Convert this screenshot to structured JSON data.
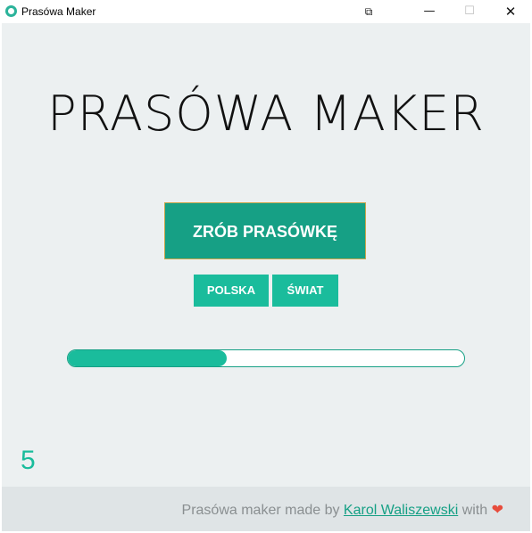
{
  "window": {
    "title": "Prasówa Maker",
    "controls": {
      "extra": "⧉",
      "minimize": "—",
      "maximize": "☐",
      "close": "✕"
    }
  },
  "main": {
    "heading": "PRASÓWA MAKER",
    "primary_button": "ZRÓB PRASÓWKĘ",
    "filter_buttons": [
      "POLSKA",
      "ŚWIAT"
    ],
    "progress_fraction": 0.4,
    "counter": "5"
  },
  "footer": {
    "prefix": "Prasówa maker made by ",
    "author": "Karol Waliszewski",
    "suffix": " with ",
    "heart": "❤"
  },
  "colors": {
    "accent": "#1abc9c",
    "accent_dark": "#16a085",
    "background": "#ecf0f1",
    "footer_bg": "#dfe4e6",
    "heart": "#e74c3c"
  },
  "icons": [
    "app-icon",
    "heart-icon"
  ]
}
